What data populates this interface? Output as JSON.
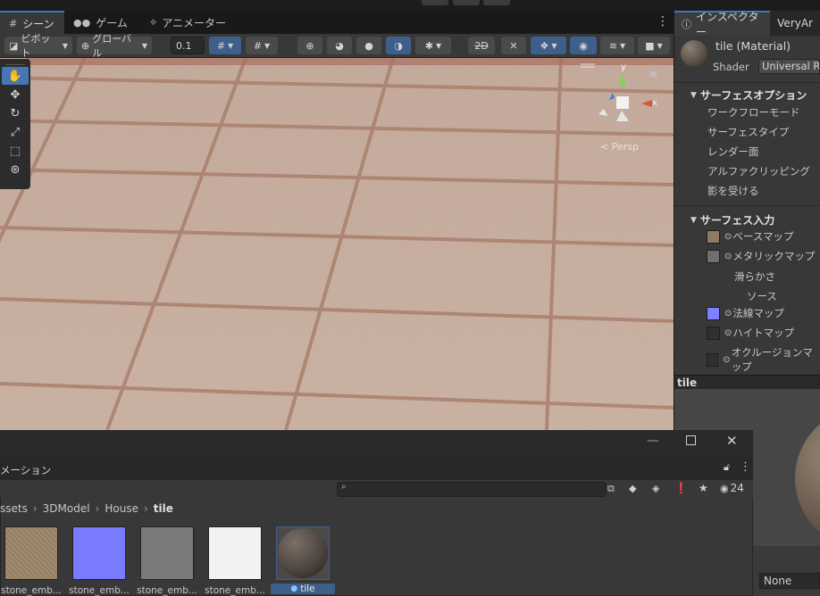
{
  "scene_tabs": [
    {
      "label": "シーン",
      "icon": "grid-icon",
      "active": true
    },
    {
      "label": "ゲーム",
      "icon": "gamepad-icon",
      "active": false
    },
    {
      "label": "アニメーター",
      "icon": "animator-icon",
      "active": false
    }
  ],
  "scene_toolbar": {
    "pivot_label": "ピボット",
    "global_label": "グローバル",
    "snap_value": "0.1",
    "mode_2d": "2D"
  },
  "scene_view": {
    "gizmo": {
      "y_label": "y",
      "x_label": "x",
      "projection_label": "< Persp"
    }
  },
  "inspector": {
    "tabs": [
      {
        "label": "インスペクター",
        "icon": "info-icon",
        "active": true
      },
      {
        "label": "VeryAr",
        "active": false
      }
    ],
    "material_name": "tile (Material)",
    "shader_label": "Shader",
    "shader_value": "Universal Re",
    "surface_options": {
      "header": "サーフェスオプション",
      "items": [
        "ワークフローモード",
        "サーフェスタイプ",
        "レンダー面",
        "アルファクリッピング",
        "影を受ける"
      ]
    },
    "surface_inputs": {
      "header": "サーフェス入力",
      "items": [
        {
          "label": "ベースマップ",
          "swatch": "#8f7a63",
          "has_picker": true
        },
        {
          "label": "メタリックマップ",
          "swatch": "#6f6f6f",
          "has_picker": true
        },
        {
          "label": "滑らかさ",
          "indent": 1
        },
        {
          "label": "ソース",
          "indent": 2
        },
        {
          "label": "法線マップ",
          "swatch": "#8080ff",
          "has_picker": true
        },
        {
          "label": "ハイトマップ",
          "swatch": "#2f2f2f",
          "has_picker": true
        },
        {
          "label": "オクルージョンマップ",
          "swatch": "#2f2f2f",
          "has_picker": true
        }
      ]
    },
    "preview_title": "tile",
    "none_value": "None"
  },
  "project": {
    "tab_label": "メーション",
    "hidden_count": "24",
    "breadcrumb": [
      "ssets",
      "3DModel",
      "House",
      "tile"
    ],
    "assets": [
      {
        "label": "stone_emb...",
        "color": "#9c8668",
        "selected": false
      },
      {
        "label": "stone_emb...",
        "color": "#7a7aff",
        "selected": false
      },
      {
        "label": "stone_emb...",
        "color": "#7a7a7a",
        "selected": false
      },
      {
        "label": "stone_emb...",
        "color": "#f2f2f2",
        "selected": false
      },
      {
        "label": "tile",
        "color": "#4a4a4a",
        "selected": true
      }
    ]
  },
  "colors": {
    "accent": "#3a79bb",
    "selected_blue": "#3e5f8a",
    "panel": "#383838"
  }
}
